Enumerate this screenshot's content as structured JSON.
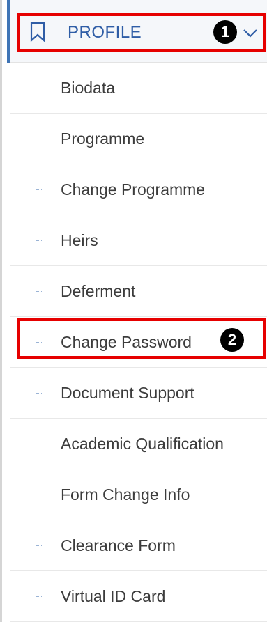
{
  "header": {
    "label": "PROFILE",
    "icon": "bookmark-icon",
    "toggle_icon": "chevron-down-icon",
    "accent_color": "#3f74b5",
    "label_color": "#2f5da6"
  },
  "menu": {
    "items": [
      {
        "label": "Biodata"
      },
      {
        "label": "Programme"
      },
      {
        "label": "Change Programme"
      },
      {
        "label": "Heirs"
      },
      {
        "label": "Deferment"
      },
      {
        "label": "Change Password"
      },
      {
        "label": "Document Support"
      },
      {
        "label": "Academic Qualification"
      },
      {
        "label": "Form Change Info"
      },
      {
        "label": "Clearance Form"
      },
      {
        "label": "Virtual ID Card"
      }
    ]
  },
  "annotations": {
    "marker_1": "1",
    "marker_2": "2",
    "highlight_color": "#e60000"
  }
}
